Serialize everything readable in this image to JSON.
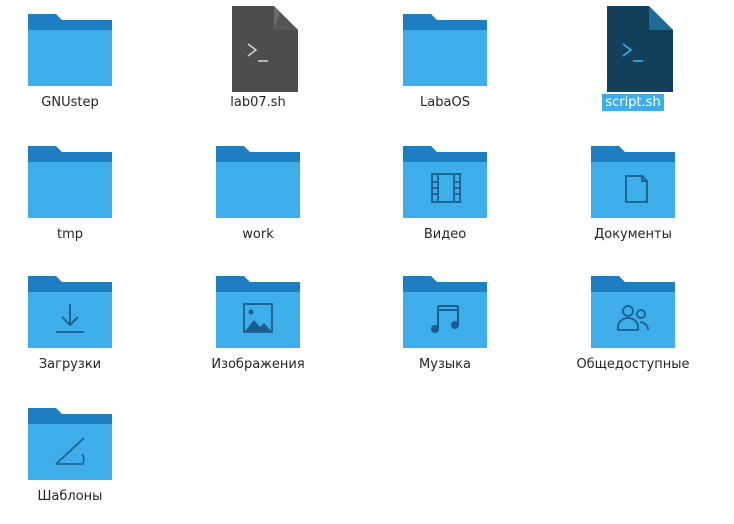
{
  "colors": {
    "folder_back": "#1d7fc2",
    "folder_front": "#3daee9",
    "folder_glyph": "#1b5d8c",
    "script_dark": "#4d4d4d",
    "script_selected": "#123f5a",
    "selection": "#3daee9"
  },
  "items": [
    {
      "label": "GNUstep",
      "icon": "folder-icon",
      "selected": false
    },
    {
      "label": "lab07.sh",
      "icon": "shell-script-icon",
      "selected": false
    },
    {
      "label": "LabaOS",
      "icon": "folder-icon",
      "selected": false
    },
    {
      "label": "script.sh",
      "icon": "shell-script-icon",
      "selected": true
    },
    {
      "label": "tmp",
      "icon": "folder-icon",
      "selected": false
    },
    {
      "label": "work",
      "icon": "folder-icon",
      "selected": false
    },
    {
      "label": "Видео",
      "icon": "folder-videos-icon",
      "selected": false
    },
    {
      "label": "Документы",
      "icon": "folder-documents-icon",
      "selected": false
    },
    {
      "label": "Загрузки",
      "icon": "folder-downloads-icon",
      "selected": false
    },
    {
      "label": "Изображения",
      "icon": "folder-pictures-icon",
      "selected": false
    },
    {
      "label": "Музыка",
      "icon": "folder-music-icon",
      "selected": false
    },
    {
      "label": "Общедоступные",
      "icon": "folder-public-icon",
      "selected": false
    },
    {
      "label": "Шаблоны",
      "icon": "folder-templates-icon",
      "selected": false
    }
  ]
}
